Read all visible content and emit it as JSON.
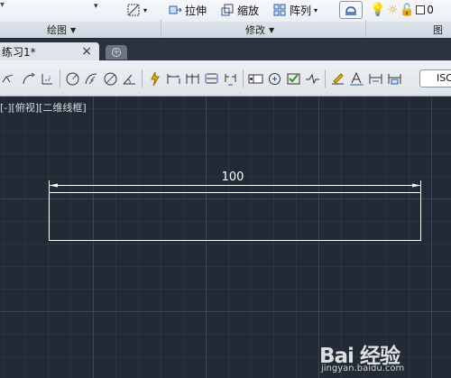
{
  "ribbon": {
    "draw_panel": "绘图",
    "modify_panel": "修改",
    "layers_panel": "图",
    "stretch": "拉伸",
    "scale": "缩放",
    "array": "阵列",
    "layer_value": "0"
  },
  "tab": {
    "title": "练习1*",
    "close": "×"
  },
  "toolbar": {
    "style_combo": "ISO"
  },
  "viewport": {
    "label": "[-][俯视][二维线框]",
    "dimension_value": "100"
  },
  "watermark": {
    "logo": "Bai 经验",
    "url": "jingyan.baidu.com"
  },
  "colors": {
    "viewport_bg": "#222a35",
    "geometry": "#ffffff",
    "toolbar_bg": "#e4e8ee"
  }
}
